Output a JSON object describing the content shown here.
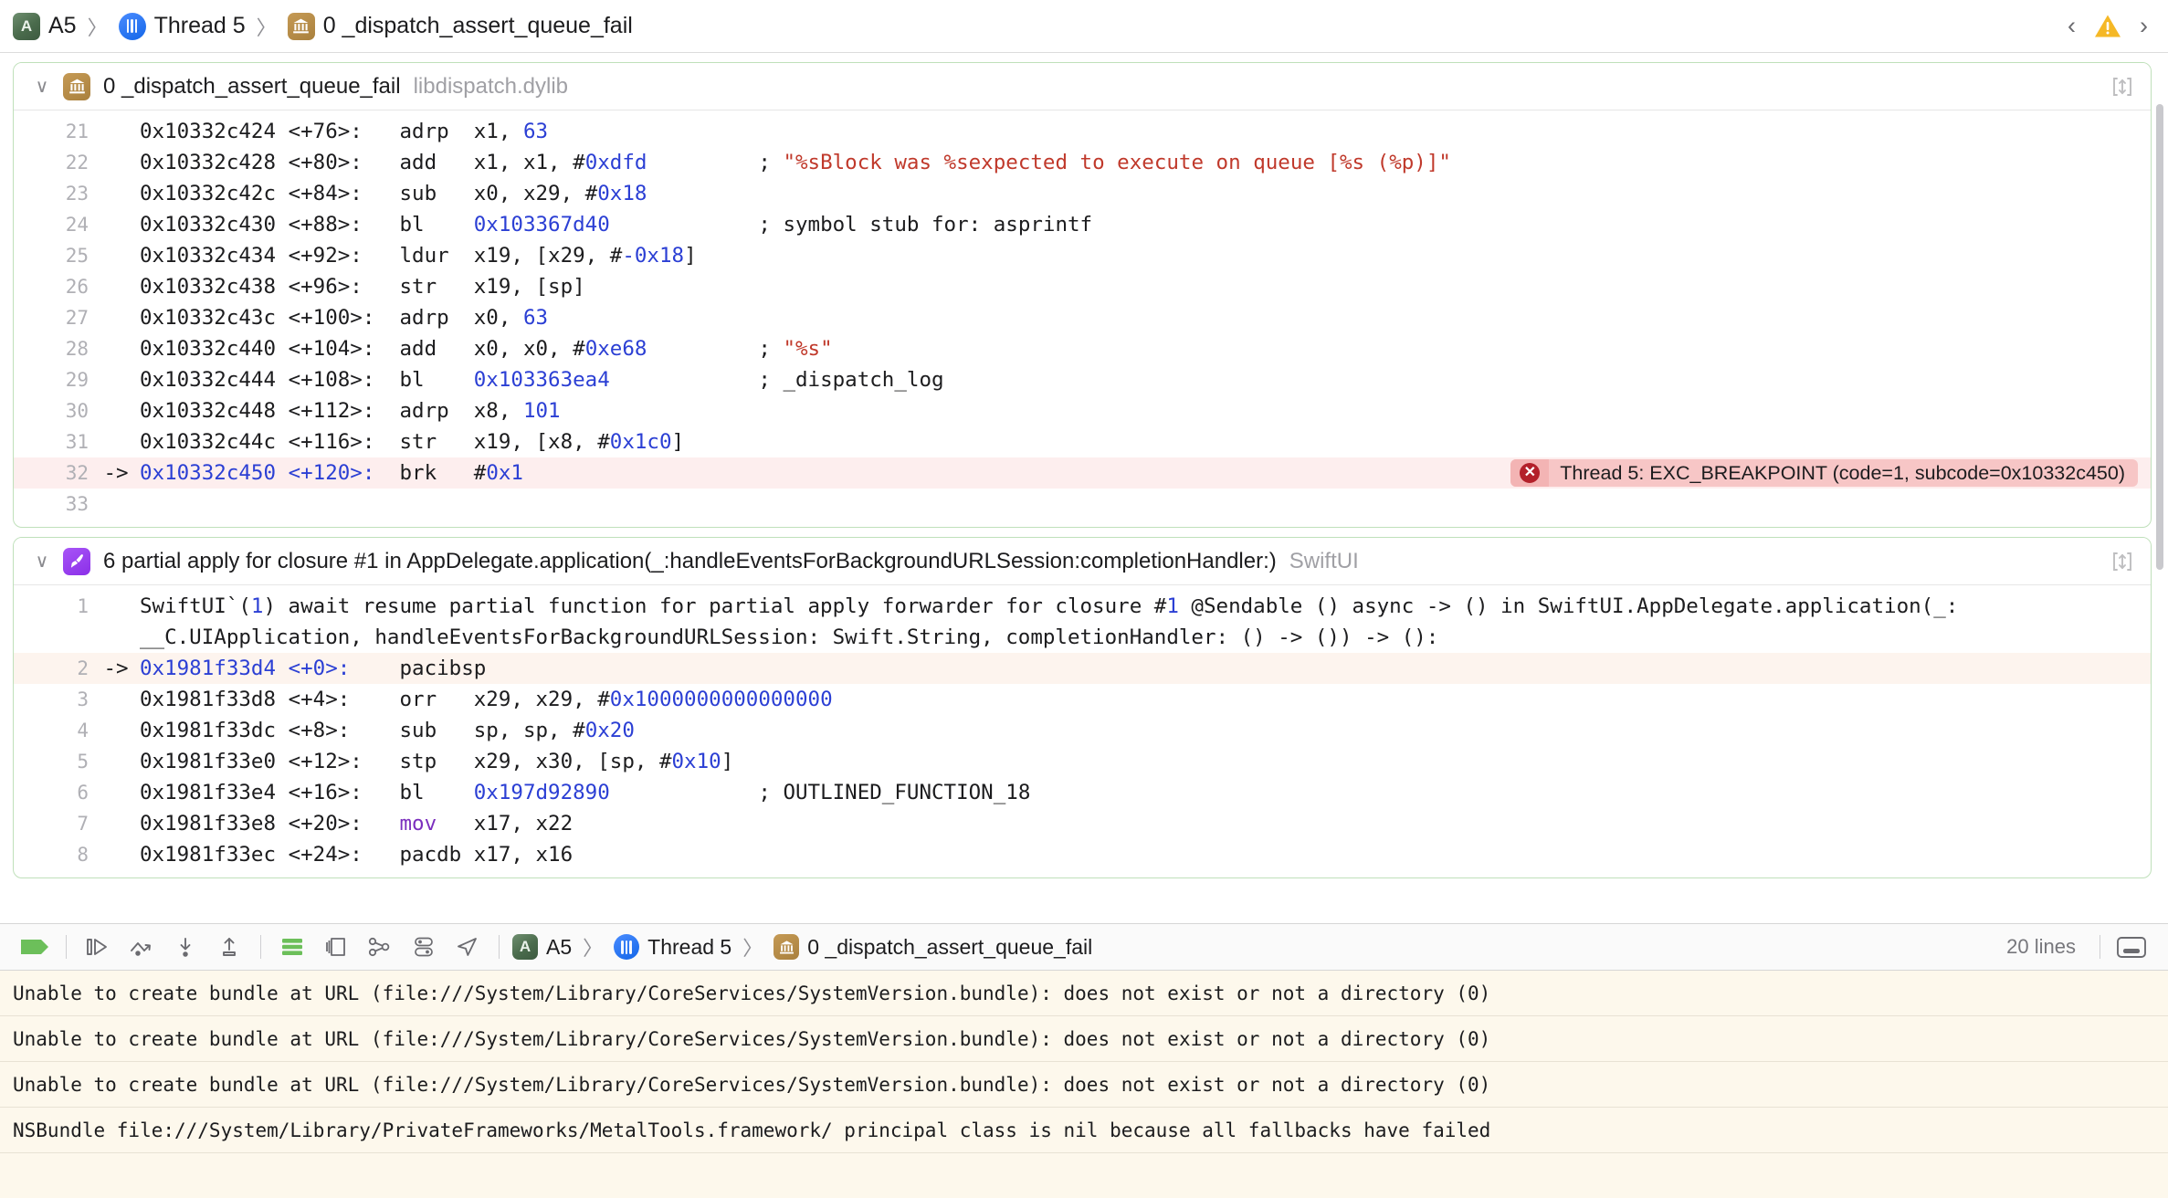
{
  "topbar": {
    "breadcrumb": [
      {
        "icon": "scheme-icon",
        "label": "A5"
      },
      {
        "icon": "thread-icon",
        "label": "Thread 5"
      },
      {
        "icon": "library-frame-icon",
        "label": "0 _dispatch_assert_queue_fail"
      }
    ],
    "separator": "〉",
    "prev_label": "‹",
    "next_label": "›",
    "warning_icon": "warning-triangle-icon",
    "accent_green": "#bfe0ba",
    "accent_blue": "#2b3fd4",
    "error_red": "#b3202a"
  },
  "frames": [
    {
      "disclosure": "∨",
      "icon": "library-frame-icon",
      "title": "0 _dispatch_assert_queue_fail",
      "module": "libdispatch.dylib",
      "expand_icon": "expand-icon",
      "lines": [
        {
          "n": "21",
          "arrow": "",
          "addr": "0x10332c424",
          "off": "<+76>:",
          "mnem": "adrp",
          "ops": "x1, ",
          "opnum": "63",
          "ops2": "",
          "comment": "",
          "comment_kind": ""
        },
        {
          "n": "22",
          "arrow": "",
          "addr": "0x10332c428",
          "off": "<+80>:",
          "mnem": "add",
          "ops": "x1, x1, #",
          "opnum": "0xdfd",
          "ops2": "",
          "comment": "\"%sBlock was %sexpected to execute on queue [%s (%p)]\"",
          "comment_kind": "str"
        },
        {
          "n": "23",
          "arrow": "",
          "addr": "0x10332c42c",
          "off": "<+84>:",
          "mnem": "sub",
          "ops": "x0, x29, #",
          "opnum": "0x18",
          "ops2": "",
          "comment": "",
          "comment_kind": ""
        },
        {
          "n": "24",
          "arrow": "",
          "addr": "0x10332c430",
          "off": "<+88>:",
          "mnem": "bl",
          "ops": "",
          "opnum": "0x103367d40",
          "ops2": "",
          "comment": "symbol stub for: asprintf",
          "comment_kind": "plain"
        },
        {
          "n": "25",
          "arrow": "",
          "addr": "0x10332c434",
          "off": "<+92>:",
          "mnem": "ldur",
          "ops": "x19, [x29, #",
          "opnum": "-0x18",
          "ops2": "]",
          "comment": "",
          "comment_kind": ""
        },
        {
          "n": "26",
          "arrow": "",
          "addr": "0x10332c438",
          "off": "<+96>:",
          "mnem": "str",
          "ops": "x19, [sp]",
          "opnum": "",
          "ops2": "",
          "comment": "",
          "comment_kind": ""
        },
        {
          "n": "27",
          "arrow": "",
          "addr": "0x10332c43c",
          "off": "<+100>:",
          "mnem": "adrp",
          "ops": "x0, ",
          "opnum": "63",
          "ops2": "",
          "comment": "",
          "comment_kind": ""
        },
        {
          "n": "28",
          "arrow": "",
          "addr": "0x10332c440",
          "off": "<+104>:",
          "mnem": "add",
          "ops": "x0, x0, #",
          "opnum": "0xe68",
          "ops2": "",
          "comment": "\"%s\"",
          "comment_kind": "str"
        },
        {
          "n": "29",
          "arrow": "",
          "addr": "0x10332c444",
          "off": "<+108>:",
          "mnem": "bl",
          "ops": "",
          "opnum": "0x103363ea4",
          "ops2": "",
          "comment": "_dispatch_log",
          "comment_kind": "plain"
        },
        {
          "n": "30",
          "arrow": "",
          "addr": "0x10332c448",
          "off": "<+112>:",
          "mnem": "adrp",
          "ops": "x8, ",
          "opnum": "101",
          "ops2": "",
          "comment": "",
          "comment_kind": ""
        },
        {
          "n": "31",
          "arrow": "",
          "addr": "0x10332c44c",
          "off": "<+116>:",
          "mnem": "str",
          "ops": "x19, [x8, #",
          "opnum": "0x1c0",
          "ops2": "]",
          "comment": "",
          "comment_kind": ""
        },
        {
          "n": "32",
          "arrow": "->",
          "addr": "0x10332c450",
          "off": "<+120>:",
          "mnem": "brk",
          "ops": "#",
          "opnum": "0x1",
          "ops2": "",
          "comment": "",
          "comment_kind": "",
          "highlight": true,
          "error": {
            "icon": "error-circle-icon",
            "text": "Thread 5: EXC_BREAKPOINT (code=1, subcode=0x10332c450)"
          }
        },
        {
          "n": "33",
          "arrow": "",
          "addr": "",
          "off": "",
          "mnem": "",
          "ops": "",
          "opnum": "",
          "ops2": "",
          "comment": "",
          "comment_kind": ""
        }
      ]
    },
    {
      "disclosure": "∨",
      "icon": "swiftui-frame-icon",
      "title": "6 partial apply for closure #1 in AppDelegate.application(_:handleEventsForBackgroundURLSession:completionHandler:)",
      "module": "SwiftUI",
      "expand_icon": "expand-icon",
      "symbol_line": {
        "n": "1",
        "prefix": "SwiftUI`(",
        "num1": "1",
        "mid": ") await resume partial function for partial apply forwarder for closure #",
        "num2": "1",
        "suffix": " @Sendable () async -> () in SwiftUI.AppDelegate.application(_: __C.UIApplication, handleEventsForBackgroundURLSession: Swift.String, completionHandler: () -> ()) -> ():"
      },
      "lines": [
        {
          "n": "2",
          "arrow": "->",
          "addr": "0x1981f33d4",
          "off": "<+0>:",
          "mnem": "pacibsp",
          "ops": "",
          "opnum": "",
          "ops2": "",
          "comment": "",
          "comment_kind": "",
          "highlight2": true
        },
        {
          "n": "3",
          "arrow": "",
          "addr": "0x1981f33d8",
          "off": "<+4>:",
          "mnem": "orr",
          "ops": "x29, x29, #",
          "opnum": "0x1000000000000000",
          "ops2": "",
          "comment": "",
          "comment_kind": ""
        },
        {
          "n": "4",
          "arrow": "",
          "addr": "0x1981f33dc",
          "off": "<+8>:",
          "mnem": "sub",
          "ops": "sp, sp, #",
          "opnum": "0x20",
          "ops2": "",
          "comment": "",
          "comment_kind": ""
        },
        {
          "n": "5",
          "arrow": "",
          "addr": "0x1981f33e0",
          "off": "<+12>:",
          "mnem": "stp",
          "ops": "x29, x30, [sp, #",
          "opnum": "0x10",
          "ops2": "]",
          "comment": "",
          "comment_kind": ""
        },
        {
          "n": "6",
          "arrow": "",
          "addr": "0x1981f33e4",
          "off": "<+16>:",
          "mnem": "bl",
          "ops": "",
          "opnum": "0x197d92890",
          "ops2": "",
          "comment": "OUTLINED_FUNCTION_18",
          "comment_kind": "plain"
        },
        {
          "n": "7",
          "arrow": "",
          "addr": "0x1981f33e8",
          "off": "<+20>:",
          "mnem": "mov",
          "mnem_alias": true,
          "ops": "x17, x22",
          "opnum": "",
          "ops2": "",
          "comment": "",
          "comment_kind": ""
        },
        {
          "n": "8",
          "arrow": "",
          "addr": "0x1981f33ec",
          "off": "<+24>:",
          "mnem": "pacdb",
          "ops": "x17, x16",
          "opnum": "",
          "ops2": "",
          "comment": "",
          "comment_kind": ""
        }
      ]
    }
  ],
  "debugbar": {
    "buttons": [
      {
        "name": "breakpoint-toggle-button",
        "icon": "breakpoint-icon"
      },
      {
        "name": "continue-button",
        "icon": "continue-icon"
      },
      {
        "name": "step-over-button",
        "icon": "step-over-icon"
      },
      {
        "name": "step-into-button",
        "icon": "step-into-icon"
      },
      {
        "name": "step-out-button",
        "icon": "step-out-icon"
      },
      {
        "name": "stack-view-button",
        "icon": "stack-bars-icon"
      },
      {
        "name": "memory-view-button",
        "icon": "layers-icon"
      },
      {
        "name": "view-hierarchy-button",
        "icon": "node-graph-icon"
      },
      {
        "name": "environment-overrides-button",
        "icon": "toggles-icon"
      },
      {
        "name": "simulate-location-button",
        "icon": "location-arrow-icon"
      }
    ],
    "breadcrumb": [
      {
        "icon": "scheme-icon",
        "label": "A5"
      },
      {
        "icon": "thread-icon",
        "label": "Thread 5"
      },
      {
        "icon": "library-frame-icon",
        "label": "0 _dispatch_assert_queue_fail"
      }
    ],
    "separator": "〉",
    "lines_label": "20 lines",
    "panel_toggle_icon": "console-panel-icon"
  },
  "console": {
    "lines": [
      "Unable to create bundle at URL (file:///System/Library/CoreServices/SystemVersion.bundle): does not exist or not a directory (0)",
      "Unable to create bundle at URL (file:///System/Library/CoreServices/SystemVersion.bundle): does not exist or not a directory (0)",
      "Unable to create bundle at URL (file:///System/Library/CoreServices/SystemVersion.bundle): does not exist or not a directory (0)",
      "NSBundle file:///System/Library/PrivateFrameworks/MetalTools.framework/ principal class is nil because all fallbacks have failed"
    ]
  }
}
